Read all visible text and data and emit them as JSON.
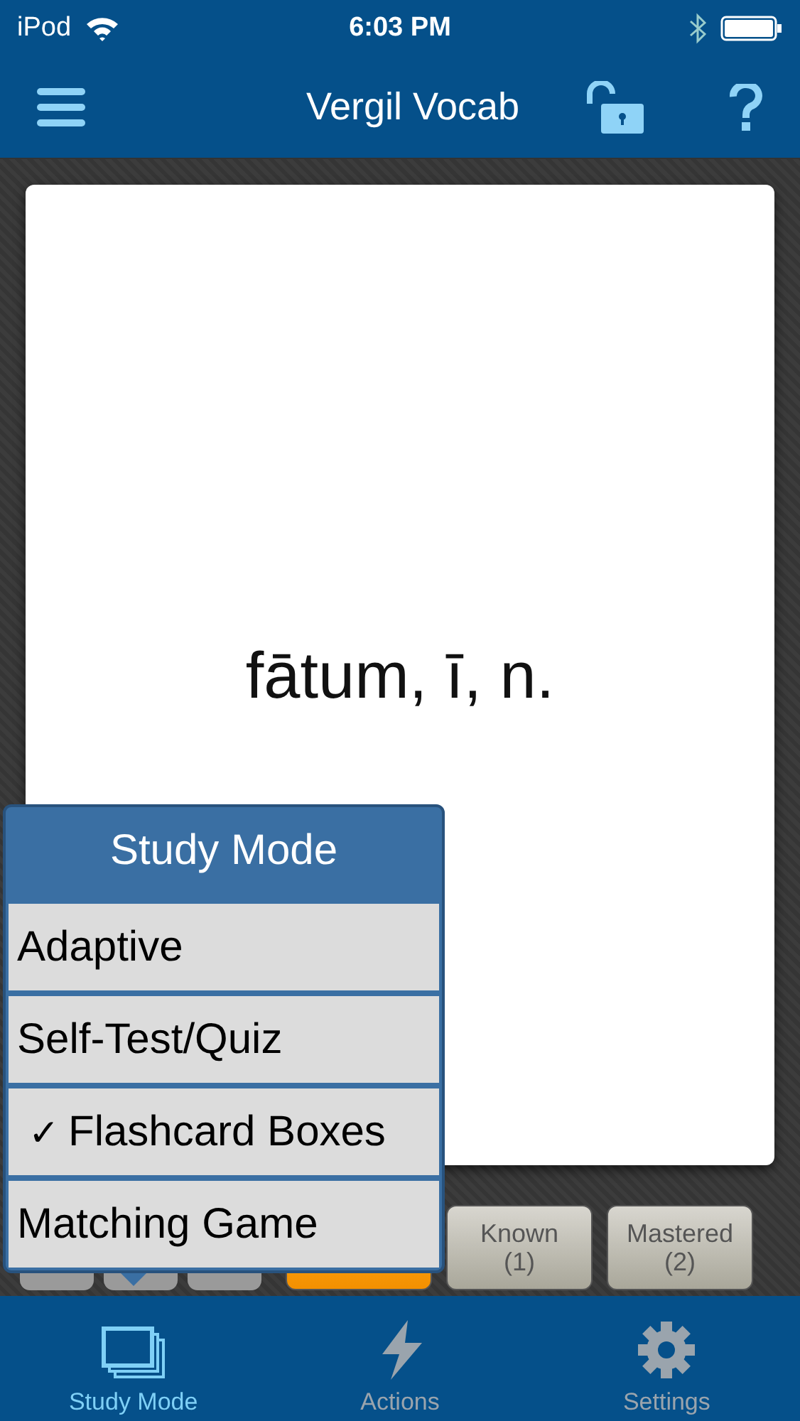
{
  "status_bar": {
    "carrier": "iPod",
    "time": "6:03 PM"
  },
  "nav_bar": {
    "title": "Vergil Vocab"
  },
  "card": {
    "term": "fātum, ī, n."
  },
  "toolbar_buttons": [
    {
      "kind": "plain"
    },
    {
      "kind": "plain"
    },
    {
      "kind": "plain"
    }
  ],
  "boxes": [
    {
      "selected": true
    },
    {
      "label": "Known",
      "count": "(1)",
      "selected": false
    },
    {
      "label": "Mastered",
      "count": "(2)",
      "selected": false
    }
  ],
  "popup": {
    "title": "Study Mode",
    "check": "✓",
    "items": [
      {
        "label": "Adaptive",
        "selected": false
      },
      {
        "label": "Self-Test/Quiz",
        "selected": false
      },
      {
        "label": "Flashcard Boxes",
        "selected": true
      },
      {
        "label": "Matching Game",
        "selected": false
      }
    ]
  },
  "tab_bar": [
    {
      "label": "Study Mode",
      "kind": "cards",
      "selected": true
    },
    {
      "label": "Actions",
      "kind": "bolt",
      "selected": false
    },
    {
      "label": "Settings",
      "kind": "gear",
      "selected": false
    }
  ]
}
